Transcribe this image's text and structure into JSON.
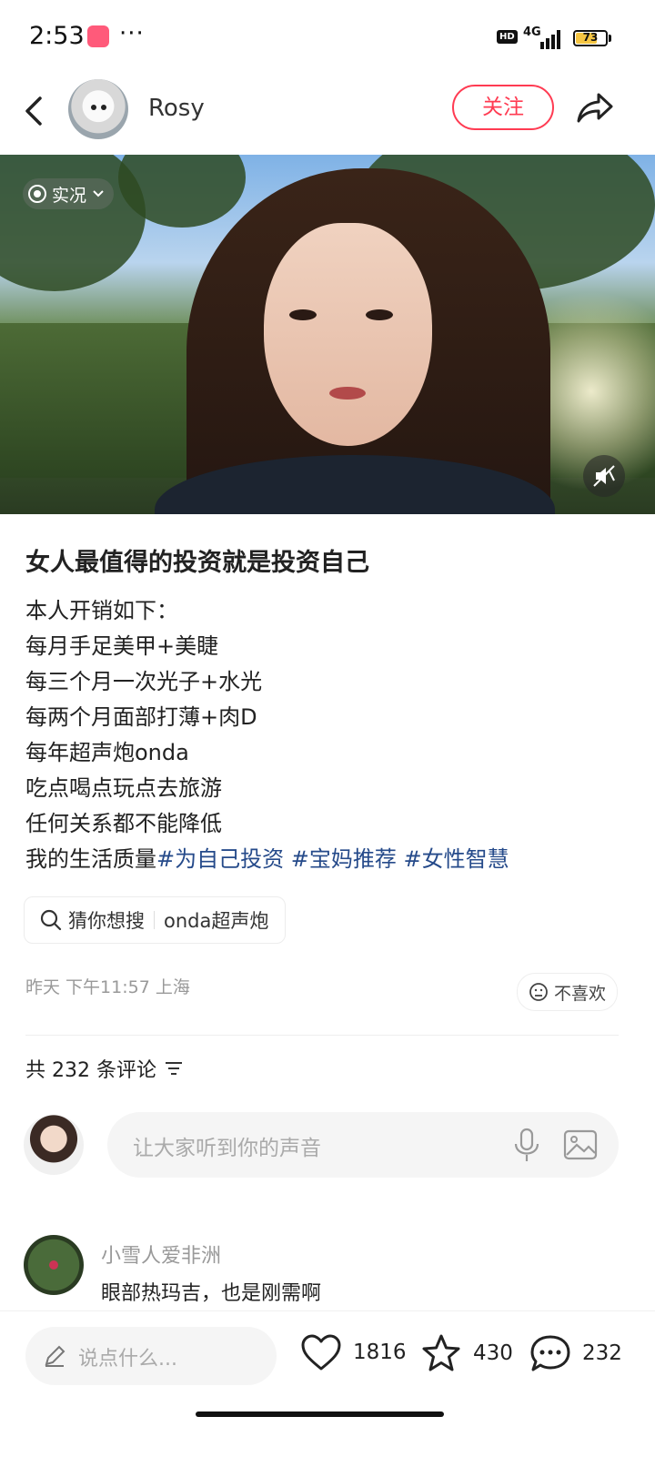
{
  "status_bar": {
    "time": "2:53",
    "more": "···",
    "hd": "HD",
    "network": "4G",
    "battery": 73
  },
  "header": {
    "author_name": "Rosy",
    "follow_label": "关注",
    "icons": [
      "back-arrow-icon",
      "share-icon"
    ]
  },
  "media": {
    "live_label": "实况",
    "mute_icon": "mute-icon"
  },
  "post": {
    "title": "女人最值得的投资就是投资自己",
    "lines": [
      "本人开销如下：",
      "每月手足美甲+美睫",
      "每三个月一次光子+水光",
      "每两个月面部打薄+肉D",
      "每年超声炮onda",
      "吃点喝点玩点去旅游",
      "任何关系都不能降低"
    ],
    "last_line_text": "我的生活质量",
    "tags": [
      "#为自己投资",
      "#宝妈推荐",
      "#女性智慧"
    ],
    "search_suggest": {
      "label": "猜你想搜",
      "query": "onda超声炮"
    },
    "meta": "昨天 下午11:57 上海",
    "dislike_label": "不喜欢"
  },
  "comments": {
    "count_label": "共 232 条评论",
    "input_placeholder": "让大家听到你的声音",
    "items": [
      {
        "user": "小雪人爱非洲",
        "text": "眼部热玛吉，也是刚需啊"
      }
    ]
  },
  "bottom_bar": {
    "say_placeholder": "说点什么...",
    "likes": "1816",
    "stars": "430",
    "comments": "232"
  },
  "colors": {
    "accent": "#ff3b52",
    "tag": "#254a8a"
  }
}
